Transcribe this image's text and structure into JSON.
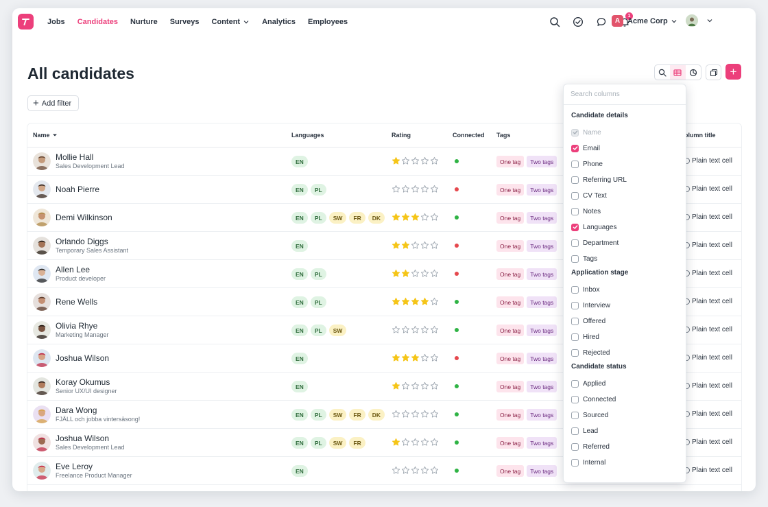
{
  "nav": {
    "links": [
      {
        "label": "Jobs",
        "active": false
      },
      {
        "label": "Candidates",
        "active": true
      },
      {
        "label": "Nurture",
        "active": false
      },
      {
        "label": "Surveys",
        "active": false
      },
      {
        "label": "Content",
        "active": false,
        "dropdown": true
      },
      {
        "label": "Analytics",
        "active": false
      },
      {
        "label": "Employees",
        "active": false
      }
    ],
    "notification_count": "1",
    "org_initial": "A",
    "org_name": "Acme Corp"
  },
  "page": {
    "title": "All candidates",
    "add_filter_label": "Add filter",
    "add_button_label": "+"
  },
  "colors": {
    "accent": "#ec3f7b",
    "connected": "#2fb344",
    "disconnected": "#e5484d",
    "star": "#f5c518"
  },
  "table": {
    "headers": {
      "name": "Name",
      "languages": "Languages",
      "rating": "Rating",
      "connected": "Connected",
      "tags": "Tags",
      "column_title": "olumn title"
    },
    "rows": [
      {
        "name": "Mollie Hall",
        "subtitle": "Sales Development Lead",
        "languages": [
          "EN"
        ],
        "rating": 1,
        "connected": true,
        "tags": [
          "One tag",
          "Two tags"
        ],
        "plain": "Plain text cell"
      },
      {
        "name": "Noah Pierre",
        "subtitle": "",
        "languages": [
          "EN",
          "PL"
        ],
        "rating": 0,
        "connected": false,
        "tags": [
          "One tag",
          "Two tags"
        ],
        "plain": "Plain text cell"
      },
      {
        "name": "Demi Wilkinson",
        "subtitle": "",
        "languages": [
          "EN",
          "PL",
          "SW",
          "FR",
          "DK"
        ],
        "rating": 3,
        "connected": true,
        "tags": [
          "One tag",
          "Two tags"
        ],
        "plain": "Plain text cell"
      },
      {
        "name": "Orlando Diggs",
        "subtitle": "Temporary Sales Assistant",
        "languages": [
          "EN"
        ],
        "rating": 2,
        "connected": false,
        "tags": [
          "One tag",
          "Two tags"
        ],
        "plain": "Plain text cell"
      },
      {
        "name": "Allen Lee",
        "subtitle": "Product developer",
        "languages": [
          "EN",
          "PL"
        ],
        "rating": 2,
        "connected": false,
        "tags": [
          "One tag",
          "Two tags"
        ],
        "plain": "Plain text cell"
      },
      {
        "name": "Rene Wells",
        "subtitle": "",
        "languages": [
          "EN",
          "PL"
        ],
        "rating": 4,
        "connected": true,
        "tags": [
          "One tag",
          "Two tags"
        ],
        "plain": "Plain text cell"
      },
      {
        "name": "Olivia Rhye",
        "subtitle": "Marketing Manager",
        "languages": [
          "EN",
          "PL",
          "SW"
        ],
        "rating": 0,
        "connected": true,
        "tags": [
          "One tag",
          "Two tags"
        ],
        "plain": "Plain text cell"
      },
      {
        "name": "Joshua Wilson",
        "subtitle": "",
        "languages": [
          "EN"
        ],
        "rating": 3,
        "connected": false,
        "tags": [
          "One tag",
          "Two tags"
        ],
        "plain": "Plain text cell"
      },
      {
        "name": "Koray Okumus",
        "subtitle": "Senior UX/UI designer",
        "languages": [
          "EN"
        ],
        "rating": 1,
        "connected": true,
        "tags": [
          "One tag",
          "Two tags"
        ],
        "plain": "Plain text cell"
      },
      {
        "name": "Dara Wong",
        "subtitle": "FJÄLL och jobba vintersäsong!",
        "languages": [
          "EN",
          "PL",
          "SW",
          "FR",
          "DK"
        ],
        "rating": 0,
        "connected": true,
        "tags": [
          "One tag",
          "Two tags"
        ],
        "plain": "Plain text cell"
      },
      {
        "name": "Joshua Wilson",
        "subtitle": "Sales Development Lead",
        "languages": [
          "EN",
          "PL",
          "SW",
          "FR"
        ],
        "rating": 1,
        "connected": true,
        "tags": [
          "One tag",
          "Two tags"
        ],
        "plain": "Plain text cell"
      },
      {
        "name": "Eve Leroy",
        "subtitle": "Freelance Product Manager",
        "languages": [
          "EN"
        ],
        "rating": 0,
        "connected": true,
        "tags": [
          "One tag",
          "Two tags"
        ],
        "plain": "Plain text cell"
      }
    ]
  },
  "column_picker": {
    "search_placeholder": "Search columns",
    "sections": [
      {
        "title": "Candidate details",
        "items": [
          {
            "label": "Name",
            "checked": true,
            "disabled": true
          },
          {
            "label": "Email",
            "checked": true,
            "disabled": false
          },
          {
            "label": "Phone",
            "checked": false,
            "disabled": false
          },
          {
            "label": "Referring URL",
            "checked": false,
            "disabled": false
          },
          {
            "label": "CV Text",
            "checked": false,
            "disabled": false
          },
          {
            "label": "Notes",
            "checked": false,
            "disabled": false
          },
          {
            "label": "Languages",
            "checked": true,
            "disabled": false
          },
          {
            "label": "Department",
            "checked": false,
            "disabled": false
          },
          {
            "label": "Tags",
            "checked": false,
            "disabled": false
          }
        ]
      },
      {
        "title": "Application stage",
        "items": [
          {
            "label": "Inbox",
            "checked": false,
            "disabled": false
          },
          {
            "label": "Interview",
            "checked": false,
            "disabled": false
          },
          {
            "label": "Offered",
            "checked": false,
            "disabled": false
          },
          {
            "label": "Hired",
            "checked": false,
            "disabled": false
          },
          {
            "label": "Rejected",
            "checked": false,
            "disabled": false
          }
        ]
      },
      {
        "title": "Candidate status",
        "items": [
          {
            "label": "Applied",
            "checked": false,
            "disabled": false
          },
          {
            "label": "Connected",
            "checked": false,
            "disabled": false
          },
          {
            "label": "Sourced",
            "checked": false,
            "disabled": false
          },
          {
            "label": "Lead",
            "checked": false,
            "disabled": false
          },
          {
            "label": "Referred",
            "checked": false,
            "disabled": false
          },
          {
            "label": "Internal",
            "checked": false,
            "disabled": false
          }
        ]
      }
    ]
  }
}
